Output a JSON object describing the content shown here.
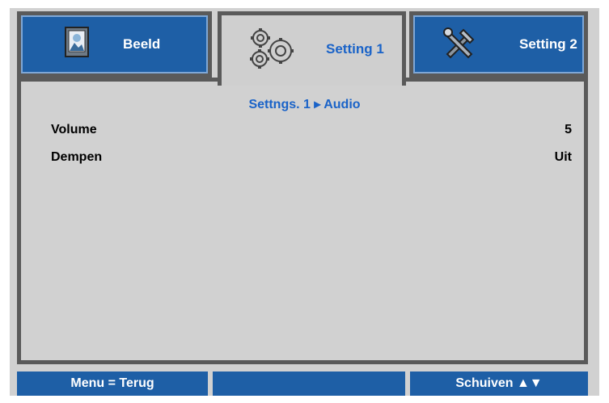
{
  "tabs": [
    {
      "label": "Beeld",
      "icon": "picture-icon",
      "active": false
    },
    {
      "label": "Setting 1",
      "icon": "gears-icon",
      "active": true
    },
    {
      "label": "Setting 2",
      "icon": "tools-icon",
      "active": false
    }
  ],
  "breadcrumb": "Settngs. 1 ▸ Audio",
  "rows": [
    {
      "label": "Volume",
      "value": "5"
    },
    {
      "label": "Dempen",
      "value": "Uit"
    }
  ],
  "footer": {
    "left": "Menu = Terug",
    "middle": "",
    "right": "Schuiven ▲▼"
  },
  "colors": {
    "tab_blue": "#1e5fa6",
    "accent_text": "#1a63c8",
    "panel_bg": "#d1d1d1",
    "border": "#5a5a5a"
  }
}
